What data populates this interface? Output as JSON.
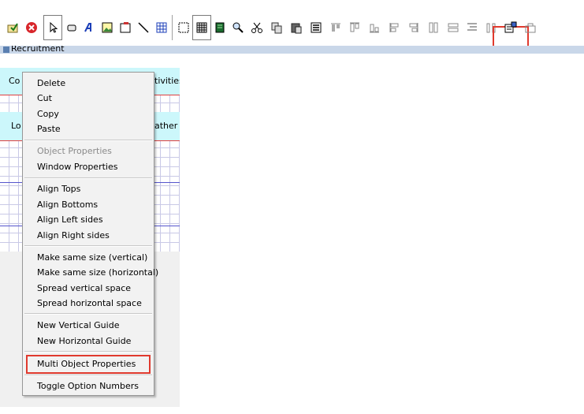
{
  "toolbar": {
    "icons": [
      "save-as-icon",
      "cancel-icon",
      "pointer-icon",
      "button-icon",
      "label-icon",
      "image-icon",
      "frame-icon",
      "line-icon",
      "table-icon",
      "rectangle-icon",
      "grid-icon",
      "green-book-icon",
      "find-icon",
      "cut-icon",
      "copy-icon",
      "paste-icon",
      "properties-icon",
      "align-tops-icon",
      "align-bottoms-icon",
      "align-left-icon",
      "align-right-icon",
      "same-height-icon",
      "same-width-icon",
      "spread-vertical-icon",
      "spread-horizontal-icon",
      "multi-object-properties-icon",
      "toggle-option-numbers-icon"
    ],
    "highlight_color": "#e03a2e"
  },
  "document_bar": {
    "title": "Recruitment"
  },
  "canvas": {
    "row1_left": "Co",
    "row1_right": "tivities",
    "row2_left": "Lo",
    "row2_right": "ather"
  },
  "context_menu": {
    "groups": [
      {
        "items": [
          {
            "label": "Delete",
            "enabled": true
          },
          {
            "label": "Cut",
            "enabled": true
          },
          {
            "label": "Copy",
            "enabled": true
          },
          {
            "label": "Paste",
            "enabled": true
          }
        ]
      },
      {
        "items": [
          {
            "label": "Object Properties",
            "enabled": false
          },
          {
            "label": "Window Properties",
            "enabled": true
          }
        ]
      },
      {
        "items": [
          {
            "label": "Align Tops",
            "enabled": true
          },
          {
            "label": "Align Bottoms",
            "enabled": true
          },
          {
            "label": "Align Left sides",
            "enabled": true
          },
          {
            "label": "Align Right sides",
            "enabled": true
          }
        ]
      },
      {
        "items": [
          {
            "label": "Make same size (vertical)",
            "enabled": true
          },
          {
            "label": "Make same size (horizontal)",
            "enabled": true
          },
          {
            "label": "Spread vertical space",
            "enabled": true
          },
          {
            "label": "Spread horizontal space",
            "enabled": true
          }
        ]
      },
      {
        "items": [
          {
            "label": "New Vertical Guide",
            "enabled": true
          },
          {
            "label": "New Horizontal Guide",
            "enabled": true
          }
        ]
      },
      {
        "items": [
          {
            "label": "Multi Object Properties",
            "enabled": true,
            "highlighted": true
          }
        ]
      },
      {
        "items": [
          {
            "label": "Toggle Option Numbers",
            "enabled": true
          }
        ]
      }
    ]
  }
}
